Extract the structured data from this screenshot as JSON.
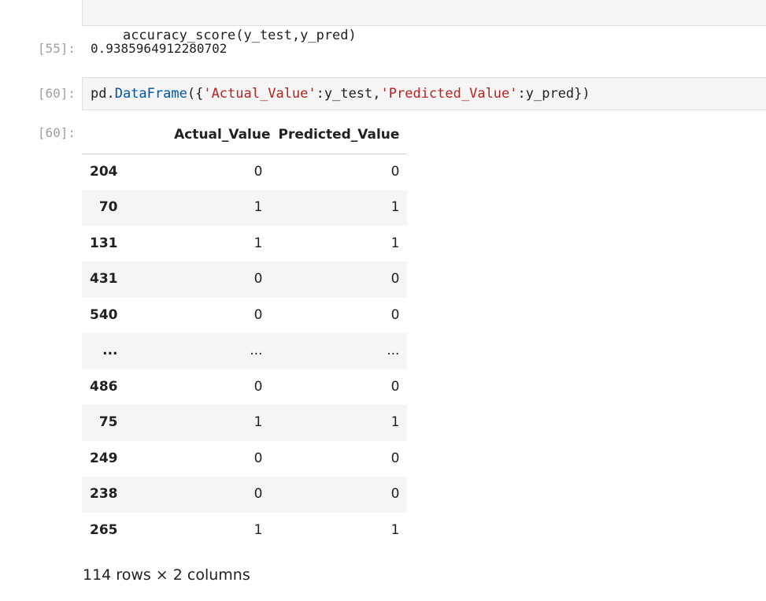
{
  "cells": {
    "cell_accuracy_code": {
      "code": "accuracy_score(y_test,y_pred)"
    },
    "cell_55_output": {
      "prompt": "[55]:",
      "value": "0.9385964912280702"
    },
    "cell_60_input": {
      "prompt": "[60]:",
      "code_parts": {
        "p1": "pd.",
        "p2": "DataFrame",
        "p3": "({",
        "p4": "'Actual_Value'",
        "p5": ":y_test,",
        "p6": "'Predicted_Value'",
        "p7": ":y_pred",
        "p8": "})"
      }
    },
    "cell_60_output": {
      "prompt": "[60]:",
      "columns": [
        "Actual_Value",
        "Predicted_Value"
      ],
      "rows": [
        {
          "index": "204",
          "actual": "0",
          "predicted": "0"
        },
        {
          "index": "70",
          "actual": "1",
          "predicted": "1"
        },
        {
          "index": "131",
          "actual": "1",
          "predicted": "1"
        },
        {
          "index": "431",
          "actual": "0",
          "predicted": "0"
        },
        {
          "index": "540",
          "actual": "0",
          "predicted": "0"
        },
        {
          "index": "...",
          "actual": "...",
          "predicted": "..."
        },
        {
          "index": "486",
          "actual": "0",
          "predicted": "0"
        },
        {
          "index": "75",
          "actual": "1",
          "predicted": "1"
        },
        {
          "index": "249",
          "actual": "0",
          "predicted": "0"
        },
        {
          "index": "238",
          "actual": "0",
          "predicted": "0"
        },
        {
          "index": "265",
          "actual": "1",
          "predicted": "1"
        }
      ],
      "shape": "114 rows × 2 columns"
    }
  },
  "colors": {
    "prompt": "#a0a0a0",
    "code_background": "#f5f5f5",
    "string": "#ba2121",
    "attribute": "#0055aa"
  }
}
